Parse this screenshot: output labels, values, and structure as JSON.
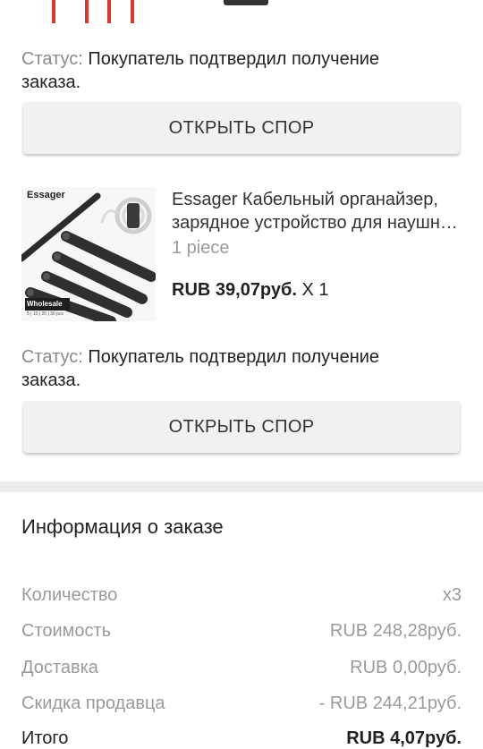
{
  "items": [
    {
      "status_label": "Статус:",
      "status_text": "Покупатель подтвердил получение заказа.",
      "button_label": "ОТКРЫТЬ СПОР"
    },
    {
      "thumb_brand": "Essager",
      "thumb_badge": "Wholesale",
      "thumb_pack": "5 | 10 | 20 | 30 pcs",
      "title_line1": "Essager Кабельный органайзер,",
      "title_line2": "зарядное устройство для наушник...",
      "variant": "1 piece",
      "price": "RUB 39,07руб.",
      "qty": "X 1",
      "status_label": "Статус:",
      "status_text": "Покупатель подтвердил получение заказа.",
      "button_label": "ОТКРЫТЬ СПОР"
    }
  ],
  "order_info": {
    "title": "Информация о заказе",
    "rows": [
      {
        "label": "Количество",
        "value": "x3"
      },
      {
        "label": "Стоимость",
        "value": "RUB 248,28руб."
      },
      {
        "label": "Доставка",
        "value": "RUB 0,00руб."
      },
      {
        "label": "Скидка продавца",
        "value": "- RUB 244,21руб."
      },
      {
        "label": "Итого",
        "value": "RUB 4,07руб."
      }
    ]
  },
  "colors": {
    "accent_red": "#d33b2f",
    "button_bg": "#f1f1f1"
  }
}
